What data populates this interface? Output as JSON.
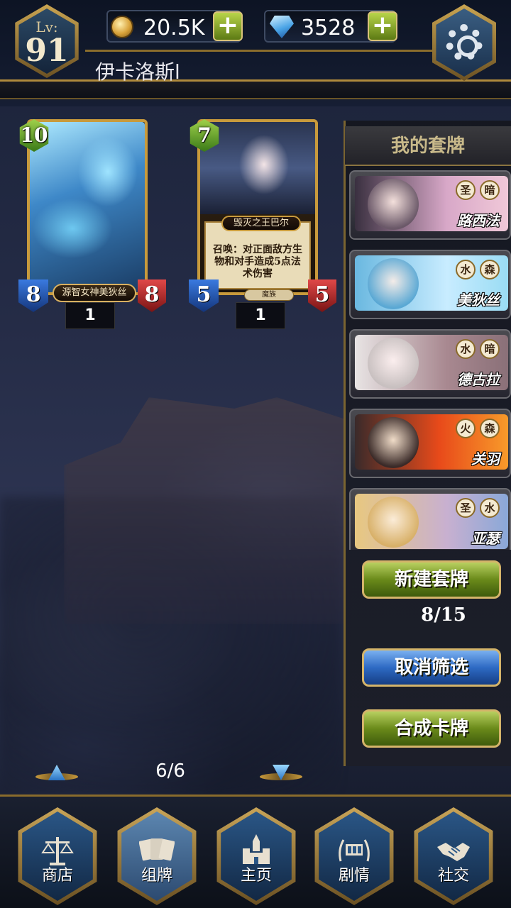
{
  "player": {
    "level_label": "Lv:",
    "level": "91",
    "name": "伊卡洛斯l"
  },
  "currency": {
    "gold": "20.5K",
    "gems": "3528",
    "add_symbol": "+"
  },
  "cards": [
    {
      "cost": "10",
      "name": "源智女神美狄丝",
      "attack": "8",
      "health": "8",
      "count": "1"
    },
    {
      "cost": "7",
      "name": "毁灭之王巴尔",
      "text": "召唤：对正面敌方生物和对手造成5点法术伤害",
      "tribe": "魔族",
      "attack": "5",
      "health": "5",
      "count": "1"
    }
  ],
  "deck_panel": {
    "title": "我的套牌",
    "decks": [
      {
        "name": "路西法",
        "elements": [
          "圣",
          "暗"
        ]
      },
      {
        "name": "美狄丝",
        "elements": [
          "水",
          "森"
        ]
      },
      {
        "name": "德古拉",
        "elements": [
          "水",
          "暗"
        ]
      },
      {
        "name": "关羽",
        "elements": [
          "火",
          "森"
        ]
      },
      {
        "name": "亚瑟",
        "elements": [
          "圣",
          "水"
        ]
      }
    ],
    "new_deck": "新建套牌",
    "deck_count": "8/15",
    "cancel_filter": "取消筛选",
    "craft_card": "合成卡牌"
  },
  "pagination": {
    "label": "6/6"
  },
  "nav": [
    {
      "label": "商店",
      "icon": "scales-icon"
    },
    {
      "label": "组牌",
      "icon": "cards-icon"
    },
    {
      "label": "主页",
      "icon": "castle-icon"
    },
    {
      "label": "剧情",
      "icon": "film-laurel-icon"
    },
    {
      "label": "社交",
      "icon": "handshake-icon"
    }
  ]
}
